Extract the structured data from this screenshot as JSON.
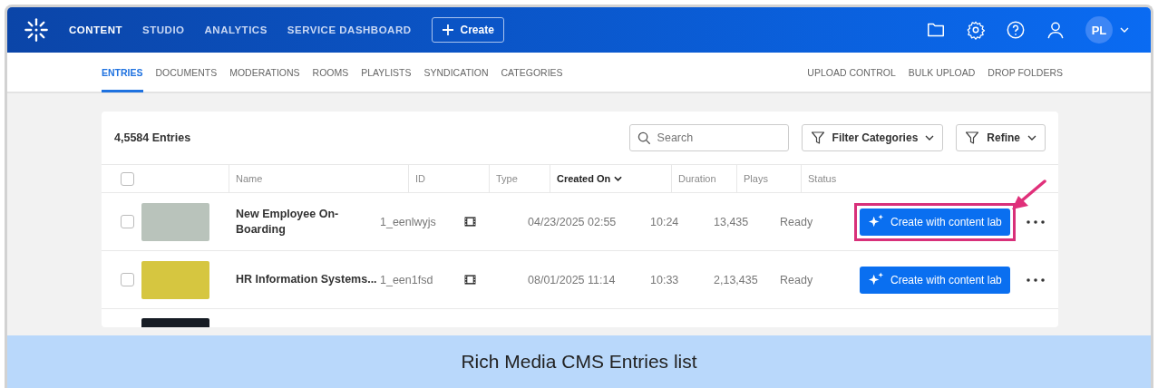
{
  "top_nav": {
    "items": [
      {
        "label": "CONTENT",
        "selected": true
      },
      {
        "label": "STUDIO",
        "selected": false
      },
      {
        "label": "ANALYTICS",
        "selected": false
      },
      {
        "label": "SERVICE DASHBOARD",
        "selected": false
      }
    ],
    "create_button": "Create",
    "avatar": "PL"
  },
  "sub_nav": {
    "tabs": [
      {
        "label": "ENTRIES",
        "selected": true
      },
      {
        "label": "DOCUMENTS",
        "selected": false
      },
      {
        "label": "MODERATIONS",
        "selected": false
      },
      {
        "label": "ROOMS",
        "selected": false
      },
      {
        "label": "PLAYLISTS",
        "selected": false
      },
      {
        "label": "SYNDICATION",
        "selected": false
      },
      {
        "label": "CATEGORIES",
        "selected": false
      }
    ],
    "actions": [
      "UPLOAD CONTROL",
      "BULK UPLOAD",
      "DROP FOLDERS"
    ]
  },
  "entries": {
    "count": "4,5584 Entries",
    "search": {
      "placeholder": "Search"
    },
    "filter_categories": "Filter Categories",
    "refine": "Refine",
    "select_all": {
      "checked": false
    },
    "columns": [
      {
        "label": "Name",
        "sorted": false
      },
      {
        "label": "ID",
        "sorted": false
      },
      {
        "label": "Type",
        "sorted": false
      },
      {
        "label": "Created On",
        "sorted": true
      },
      {
        "label": "Duration",
        "sorted": false
      },
      {
        "label": "Plays",
        "sorted": false
      },
      {
        "label": "Status",
        "sorted": false
      }
    ],
    "rows": [
      {
        "checked": false,
        "color": "#b9c3bb",
        "name": "New Employee On-Boarding",
        "id": "1_eenlwyjs",
        "created_on": "04/23/2025 02:55",
        "duration": "10:24",
        "plays": "13,435",
        "status": "Ready",
        "action": "Create with content lab",
        "highlighted": true
      },
      {
        "checked": false,
        "color": "#d6c640",
        "name": "HR Information Systems...",
        "id": "1_een1fsd",
        "created_on": "08/01/2025 11:14",
        "duration": "10:33",
        "plays": "2,13,435",
        "status": "Ready",
        "action": "Create with content lab",
        "highlighted": false
      },
      {
        "color": "#161c24"
      }
    ]
  },
  "caption": "Rich Media CMS Entries list"
}
